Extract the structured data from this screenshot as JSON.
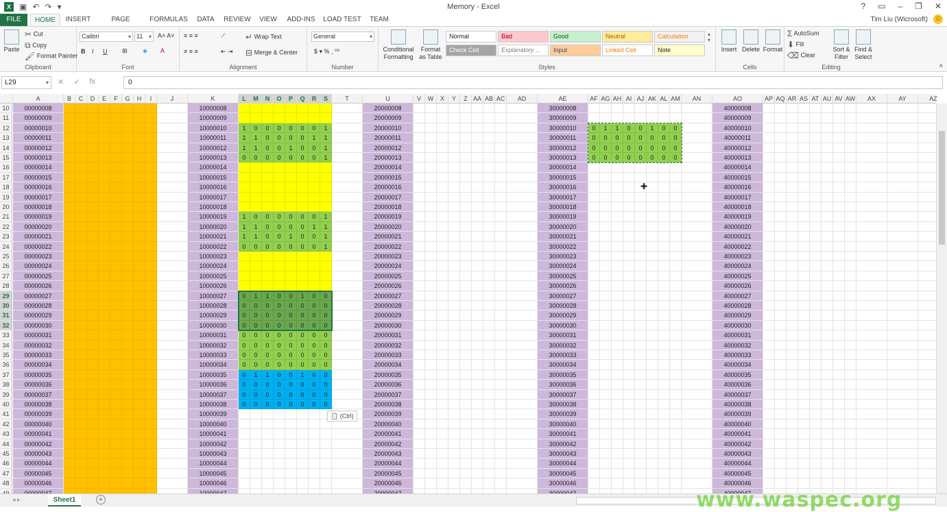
{
  "window": {
    "title": "Memory - Excel"
  },
  "tabs": [
    "FILE",
    "HOME",
    "INSERT",
    "PAGE LAYOUT",
    "FORMULAS",
    "DATA",
    "REVIEW",
    "VIEW",
    "ADD-INS",
    "LOAD TEST",
    "TEAM"
  ],
  "user": "Tim Liu (Wicrosoft)",
  "ribbon": {
    "clipboard": {
      "paste": "Paste",
      "cut": "Cut",
      "copy": "Copy",
      "format_painter": "Format Painter",
      "label": "Clipboard"
    },
    "font": {
      "name": "Calibri",
      "size": "11",
      "label": "Font"
    },
    "alignment": {
      "wrap": "Wrap Text",
      "merge": "Merge & Center",
      "label": "Alignment"
    },
    "number": {
      "format": "General",
      "label": "Number"
    },
    "styles": {
      "conditional": "Conditional Formatting",
      "format_table": "Format as Table",
      "label": "Styles",
      "cells": [
        {
          "name": "Normal",
          "bg": "#ffffff",
          "fg": "#222222"
        },
        {
          "name": "Bad",
          "bg": "#ffc7ce",
          "fg": "#9c0006"
        },
        {
          "name": "Good",
          "bg": "#c6efce",
          "fg": "#006100"
        },
        {
          "name": "Neutral",
          "bg": "#ffeb9c",
          "fg": "#9c6500"
        },
        {
          "name": "Calculation",
          "bg": "#f2f2f2",
          "fg": "#fa7d00"
        },
        {
          "name": "Check Cell",
          "bg": "#a5a5a5",
          "fg": "#ffffff"
        },
        {
          "name": "Explanatory ...",
          "bg": "#ffffff",
          "fg": "#7f7f7f"
        },
        {
          "name": "Input",
          "bg": "#ffcc99",
          "fg": "#3f3f76"
        },
        {
          "name": "Linked Cell",
          "bg": "#ffffff",
          "fg": "#fa7d00"
        },
        {
          "name": "Note",
          "bg": "#ffffcc",
          "fg": "#222222"
        }
      ]
    },
    "cells": {
      "insert": "Insert",
      "delete": "Delete",
      "format": "Format",
      "label": "Cells"
    },
    "editing": {
      "autosum": "AutoSum",
      "fill": "Fill",
      "clear": "Clear",
      "sort": "Sort & Filter",
      "find": "Find & Select",
      "label": "Editing"
    }
  },
  "formula_bar": {
    "name_box": "L29",
    "value": "0"
  },
  "columns": [
    "A",
    "B",
    "C",
    "D",
    "E",
    "F",
    "G",
    "H",
    "I",
    "J",
    "K",
    "L",
    "M",
    "N",
    "O",
    "P",
    "Q",
    "R",
    "S",
    "T",
    "U",
    "V",
    "W",
    "X",
    "Y",
    "Z",
    "AA",
    "AB",
    "AC",
    "AD",
    "AE",
    "AF",
    "AG",
    "AH",
    "AI",
    "AJ",
    "AK",
    "AL",
    "AM",
    "AN",
    "AO",
    "AP",
    "AQ",
    "AR",
    "AS",
    "AT",
    "AU",
    "AV",
    "AW",
    "AX",
    "AY",
    "AZ"
  ],
  "rows": {
    "numbers": [
      10,
      11,
      12,
      13,
      14,
      15,
      16,
      17,
      18,
      19,
      20,
      21,
      22,
      23,
      24,
      25,
      26,
      27,
      28,
      29,
      30,
      31,
      32,
      33,
      34,
      35,
      36,
      37,
      38,
      39,
      40,
      41,
      42,
      43,
      44,
      45,
      46,
      47,
      48,
      49
    ],
    "A": [
      "00000008",
      "00000009",
      "00000010",
      "00000011",
      "00000012",
      "00000013",
      "00000014",
      "00000015",
      "00000016",
      "00000017",
      "00000018",
      "00000019",
      "00000020",
      "00000021",
      "00000022",
      "00000023",
      "00000024",
      "00000025",
      "00000026",
      "00000027",
      "00000028",
      "00000029",
      "00000030",
      "00000031",
      "00000032",
      "00000033",
      "00000034",
      "00000035",
      "00000036",
      "00000037",
      "00000038",
      "00000039",
      "00000040",
      "00000041",
      "00000042",
      "00000043",
      "00000044",
      "00000045",
      "00000046",
      "00000047"
    ],
    "K": [
      "10000008",
      "10000009",
      "10000010",
      "10000011",
      "10000012",
      "10000013",
      "10000014",
      "10000015",
      "10000016",
      "10000017",
      "10000018",
      "10000019",
      "10000020",
      "10000021",
      "10000022",
      "10000023",
      "10000024",
      "10000025",
      "10000026",
      "10000027",
      "10000028",
      "10000029",
      "10000030",
      "10000031",
      "10000032",
      "10000033",
      "10000034",
      "10000035",
      "10000036",
      "10000037",
      "10000038",
      "10000039",
      "10000040",
      "10000041",
      "10000042",
      "10000043",
      "10000044",
      "10000045",
      "10000046",
      "10000047"
    ],
    "U": [
      "20000008",
      "20000009",
      "20000010",
      "20000011",
      "20000012",
      "20000013",
      "20000014",
      "20000015",
      "20000016",
      "20000017",
      "20000018",
      "20000019",
      "20000020",
      "20000021",
      "20000022",
      "20000023",
      "20000024",
      "20000025",
      "20000026",
      "20000027",
      "20000028",
      "20000029",
      "20000030",
      "20000031",
      "20000032",
      "20000033",
      "20000034",
      "20000035",
      "20000036",
      "20000037",
      "20000038",
      "20000039",
      "20000040",
      "20000041",
      "20000042",
      "20000043",
      "20000044",
      "20000045",
      "20000046",
      "20000047"
    ],
    "AE": [
      "30000008",
      "30000009",
      "30000010",
      "30000011",
      "30000012",
      "30000013",
      "30000014",
      "30000015",
      "30000016",
      "30000017",
      "30000018",
      "30000019",
      "30000020",
      "30000021",
      "30000022",
      "30000023",
      "30000024",
      "30000025",
      "30000026",
      "30000027",
      "30000028",
      "30000029",
      "30000030",
      "30000031",
      "30000032",
      "30000033",
      "30000034",
      "30000035",
      "30000036",
      "30000037",
      "30000038",
      "30000039",
      "30000040",
      "30000041",
      "30000042",
      "30000043",
      "30000044",
      "30000045",
      "30000046",
      "30000047"
    ],
    "AO": [
      "40000008",
      "40000009",
      "40000010",
      "40000011",
      "40000012",
      "40000013",
      "40000014",
      "40000015",
      "40000016",
      "40000017",
      "40000018",
      "40000019",
      "40000020",
      "40000021",
      "40000022",
      "40000023",
      "40000024",
      "40000025",
      "40000026",
      "40000027",
      "40000028",
      "40000029",
      "40000030",
      "40000031",
      "40000032",
      "40000033",
      "40000034",
      "40000035",
      "40000036",
      "40000037",
      "40000038",
      "40000039",
      "40000040",
      "40000041",
      "40000042",
      "40000043",
      "40000044",
      "40000045",
      "40000046",
      "40000047"
    ]
  },
  "bits": {
    "12": [
      "1",
      "0",
      "0",
      "0",
      "0",
      "0",
      "0",
      "1"
    ],
    "13": [
      "1",
      "1",
      "0",
      "0",
      "0",
      "0",
      "1",
      "1"
    ],
    "14": [
      "1",
      "1",
      "0",
      "0",
      "1",
      "0",
      "0",
      "1"
    ],
    "15": [
      "0",
      "0",
      "0",
      "0",
      "0",
      "0",
      "0",
      "1"
    ],
    "21": [
      "1",
      "0",
      "0",
      "0",
      "0",
      "0",
      "0",
      "1"
    ],
    "22": [
      "1",
      "1",
      "0",
      "0",
      "0",
      "0",
      "1",
      "1"
    ],
    "23": [
      "1",
      "1",
      "0",
      "0",
      "1",
      "0",
      "0",
      "1"
    ],
    "24": [
      "0",
      "0",
      "0",
      "0",
      "0",
      "0",
      "0",
      "1"
    ],
    "29": [
      "0",
      "1",
      "1",
      "0",
      "0",
      "1",
      "0",
      "0"
    ],
    "30": [
      "0",
      "0",
      "0",
      "0",
      "0",
      "0",
      "0",
      "0"
    ],
    "31": [
      "0",
      "0",
      "0",
      "0",
      "0",
      "0",
      "0",
      "0"
    ],
    "32": [
      "0",
      "0",
      "0",
      "0",
      "0",
      "0",
      "0",
      "0"
    ],
    "33": [
      "0",
      "0",
      "0",
      "0",
      "0",
      "0",
      "0",
      "0"
    ],
    "34": [
      "0",
      "0",
      "0",
      "0",
      "0",
      "0",
      "0",
      "0"
    ],
    "35": [
      "0",
      "0",
      "0",
      "0",
      "0",
      "0",
      "0",
      "0"
    ],
    "36": [
      "0",
      "0",
      "0",
      "0",
      "0",
      "0",
      "0",
      "0"
    ],
    "37": [
      "0",
      "1",
      "1",
      "0",
      "0",
      "1",
      "0",
      "0"
    ],
    "38": [
      "0",
      "0",
      "0",
      "0",
      "0",
      "0",
      "0",
      "0"
    ],
    "39": [
      "0",
      "0",
      "0",
      "0",
      "0",
      "0",
      "0",
      "0"
    ],
    "40": [
      "0",
      "0",
      "0",
      "0",
      "0",
      "0",
      "0",
      "0"
    ]
  },
  "bits_af": {
    "12": [
      "0",
      "1",
      "1",
      "0",
      "0",
      "1",
      "0",
      "0"
    ],
    "13": [
      "0",
      "0",
      "0",
      "0",
      "0",
      "0",
      "0",
      "0"
    ],
    "14": [
      "0",
      "0",
      "0",
      "0",
      "0",
      "0",
      "0",
      "0"
    ],
    "15": [
      "0",
      "0",
      "0",
      "0",
      "0",
      "0",
      "0",
      "0"
    ]
  },
  "paste_options": "(Ctrl)",
  "sheet": {
    "name": "Sheet1"
  },
  "watermark": "www.waspec.org",
  "colors": {
    "excel_green": "#217346",
    "orange": "#ffc000",
    "yellow": "#ffff00",
    "green": "#92d050",
    "dark_green": "#6aa84f",
    "blue": "#00b0f0",
    "address_purple": "#cdb7db"
  }
}
